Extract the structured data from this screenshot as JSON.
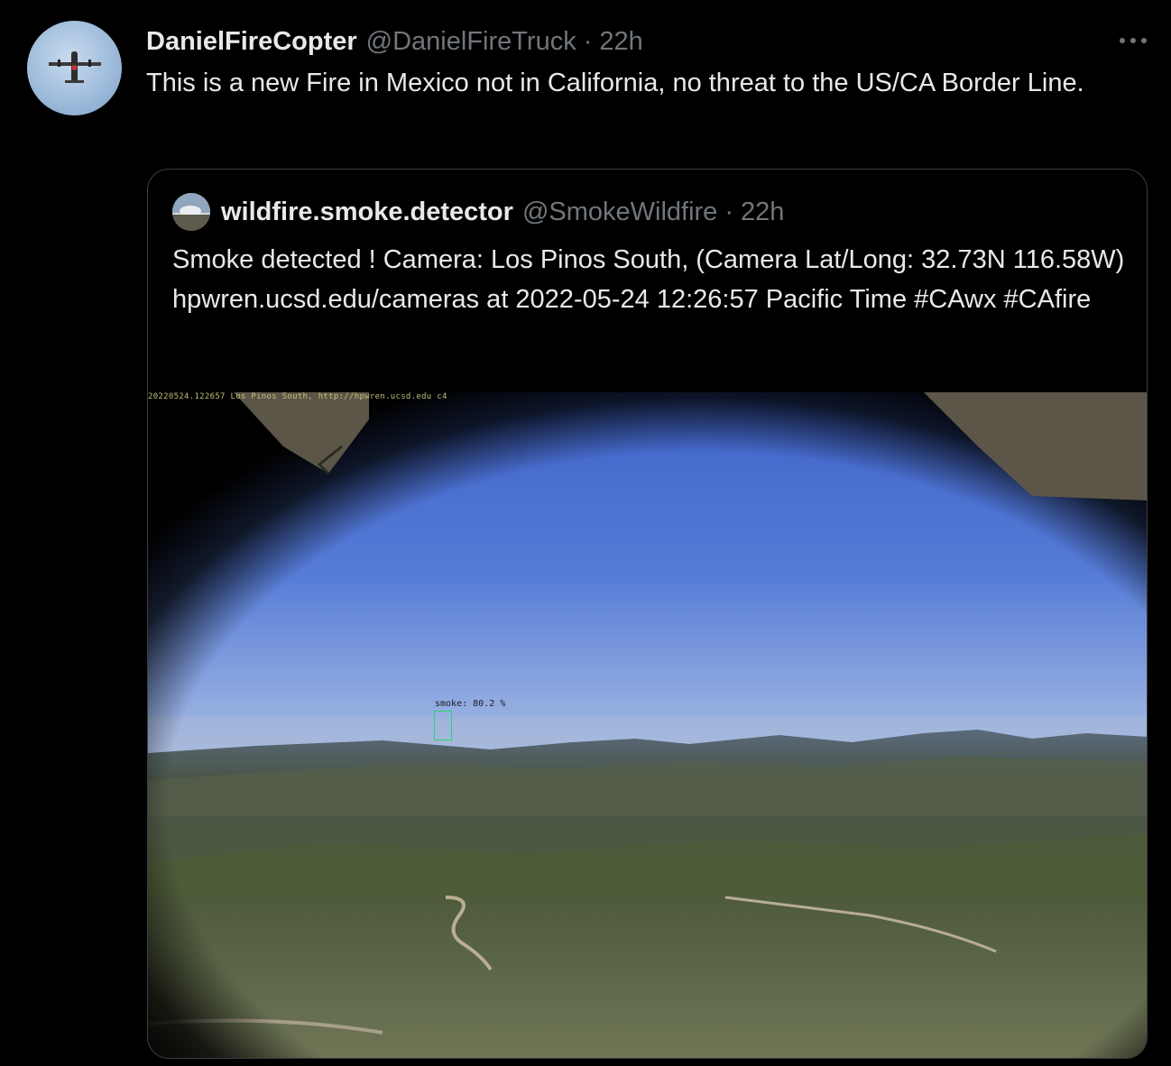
{
  "tweet": {
    "display_name": "DanielFireCopter",
    "handle": "@DanielFireTruck",
    "separator": "·",
    "time": "22h",
    "text": "This is a new Fire in Mexico not in California, no threat to the US/CA Border Line.",
    "avatar_icon": "airplane-avatar",
    "more_icon": "more-horizontal-icon"
  },
  "quoted": {
    "display_name": "wildfire.smoke.detector",
    "handle": "@SmokeWildfire",
    "separator": "·",
    "time": "22h",
    "text": "Smoke detected ! Camera: Los Pinos South, (Camera Lat/Long: 32.73N 116.58W) hpwren.ucsd.edu/cameras at 2022-05-24 12:26:57 Pacific Time #CAwx #CAfire",
    "avatar_icon": "smoke-avatar"
  },
  "media": {
    "caption": "20220524.122657  Los  Pinos  South,  http://hpwren.ucsd.edu  c4",
    "detection_label": "smoke: 80.2 %"
  },
  "colors": {
    "background": "#000000",
    "text": "#e7e9ea",
    "secondary": "#71767b",
    "border": "#3a3f44",
    "detection_box": "#2fd36a"
  }
}
